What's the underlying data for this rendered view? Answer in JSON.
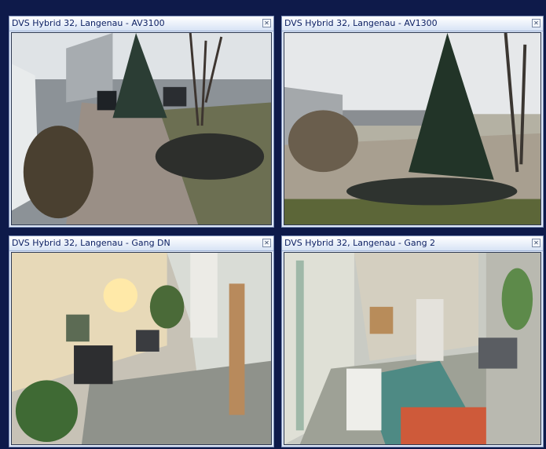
{
  "panes": [
    {
      "title": "DVS Hybrid 32, Langenau - AV3100",
      "close_icon": "close-icon"
    },
    {
      "title": "DVS Hybrid 32, Langenau - AV1300",
      "close_icon": "close-icon"
    },
    {
      "title": "DVS Hybrid 32, Langenau - Gang DN",
      "close_icon": "close-icon"
    },
    {
      "title": "DVS Hybrid 32, Langenau - Gang 2",
      "close_icon": "close-icon"
    }
  ],
  "colors": {
    "background": "#0e1a4a",
    "titlebar_text": "#0c1f62"
  }
}
